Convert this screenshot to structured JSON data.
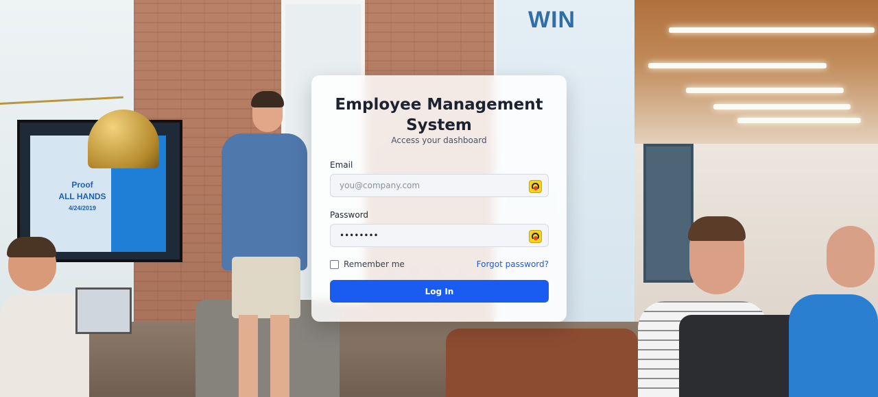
{
  "background": {
    "tv_slide": {
      "line1": "Proof",
      "line2": "ALL HANDS",
      "date": "4/24/2019"
    },
    "mural_text": "WIN"
  },
  "login": {
    "title": "Employee Management System",
    "subtitle": "Access your dashboard",
    "email_label": "Email",
    "email_placeholder": "you@company.com",
    "email_value": "",
    "password_label": "Password",
    "password_value": "••••••••",
    "remember_label": "Remember me",
    "remember_checked": false,
    "forgot_label": "Forgot password?",
    "submit_label": "Log In"
  },
  "colors": {
    "primary_button": "#1a5cf0",
    "link": "#1f5bd6"
  },
  "icons": {
    "email_field_icon": "password-manager-icon",
    "password_field_icon": "password-manager-icon"
  }
}
